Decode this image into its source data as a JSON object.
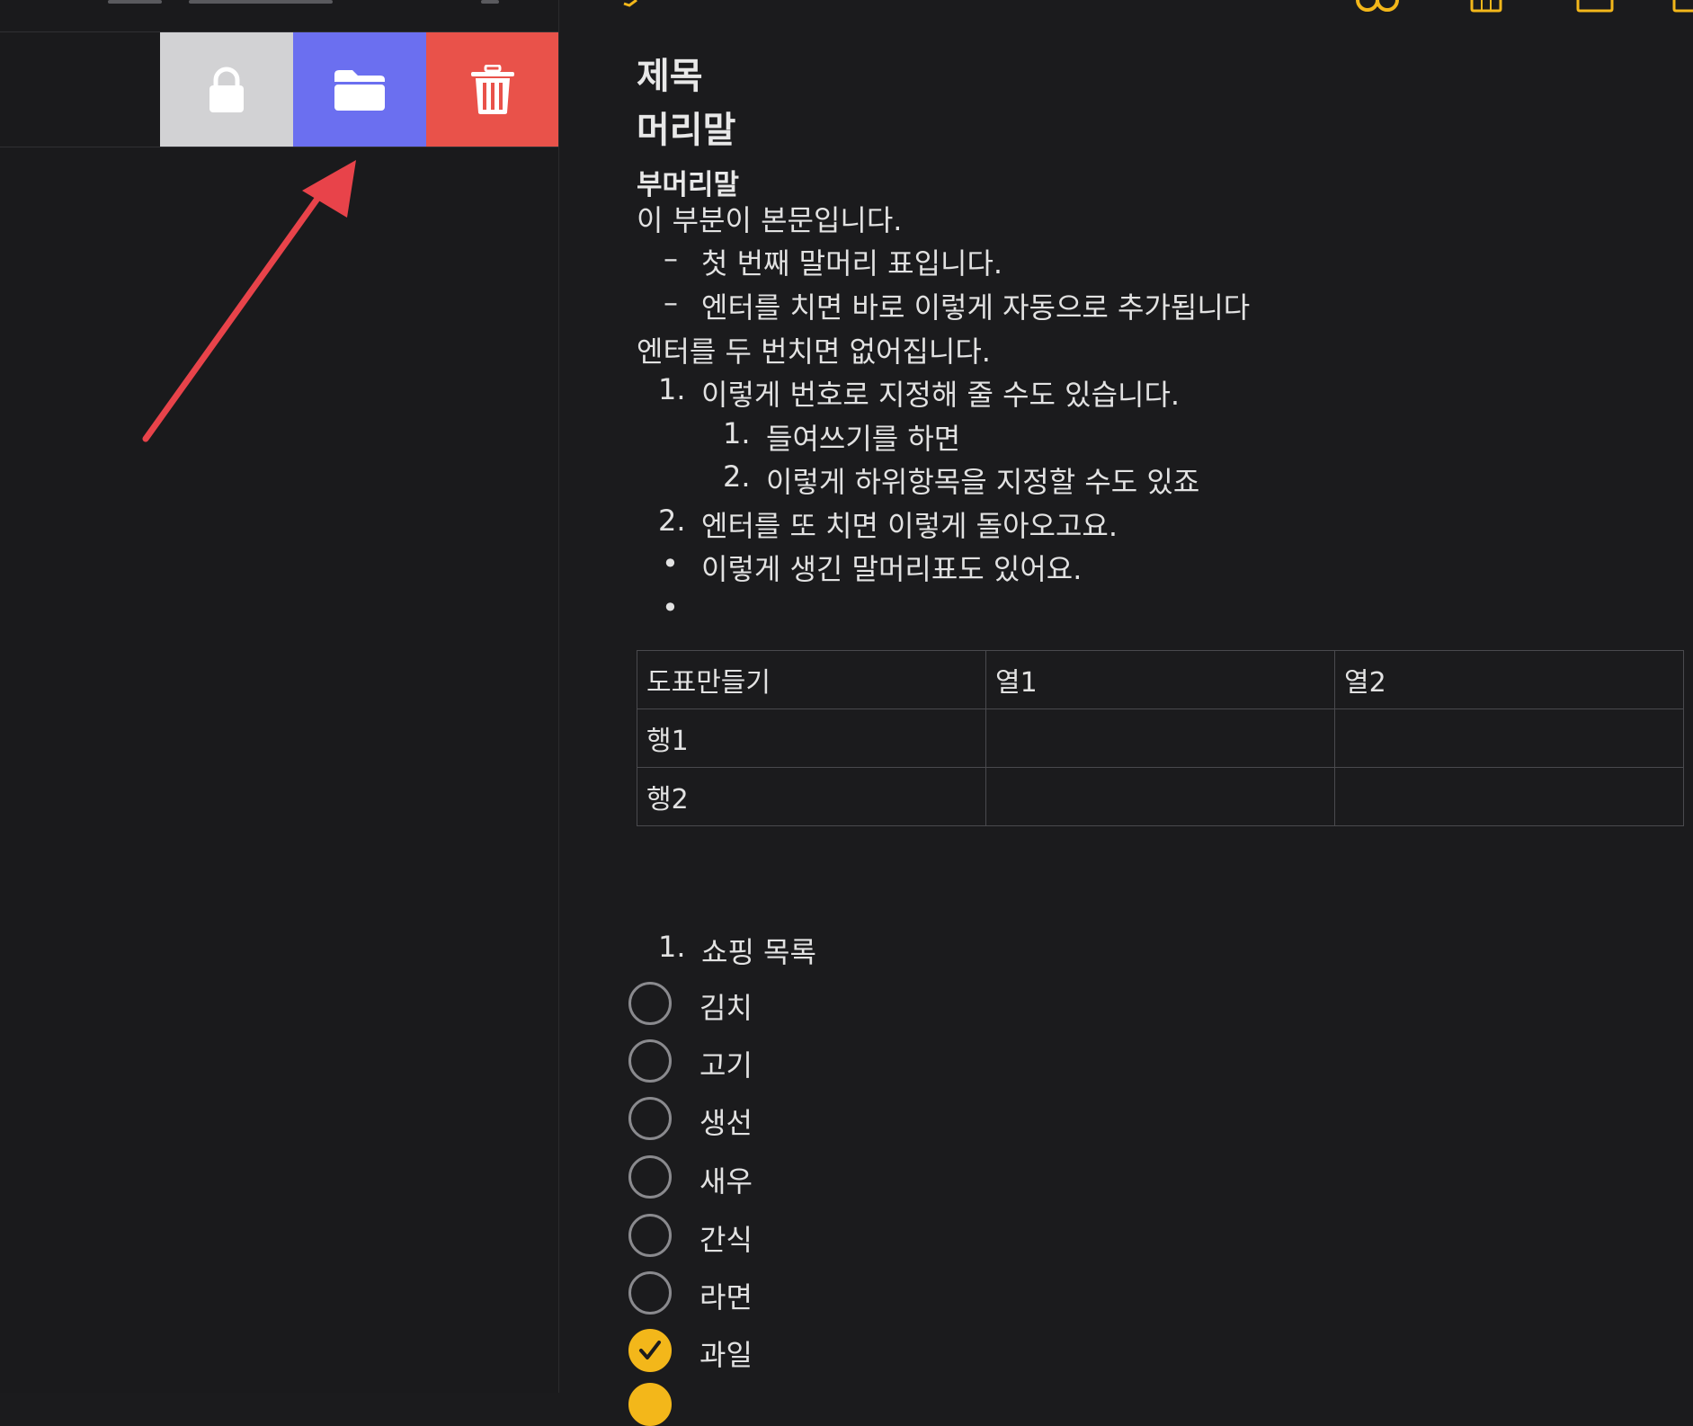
{
  "colors": {
    "background": "#1b1b1d",
    "lock": "#d2d2d4",
    "move": "#6b6ff0",
    "delete": "#e9524a",
    "accent": "#f3b71a",
    "arrow": "#e8434a"
  },
  "sidebar": {
    "actions": [
      {
        "name": "lock",
        "icon": "lock-icon"
      },
      {
        "name": "move-to-folder",
        "icon": "folder-icon"
      },
      {
        "name": "delete",
        "icon": "trash-icon"
      }
    ]
  },
  "note": {
    "title": "제목",
    "heading": "머리말",
    "subheading": "부머리말",
    "body": "이 부분이 본문입니다.",
    "dash_items": [
      "첫 번째 말머리 표입니다.",
      "엔터를 치면 바로 이렇게 자동으로 추가됩니다"
    ],
    "after_dash": "엔터를 두 번치면 없어집니다.",
    "numbered": [
      {
        "marker": "1.",
        "text": "이렇게 번호로 지정해 줄 수도 있습니다."
      },
      {
        "marker": "1.",
        "text": "들여쓰기를 하면"
      },
      {
        "marker": "2.",
        "text": "이렇게 하위항목을 지정할 수도 있죠"
      },
      {
        "marker": "2.",
        "text": "엔터를 또 치면 이렇게 돌아오고요."
      }
    ],
    "bullets": [
      "이렇게 생긴 말머리표도 있어요.",
      ""
    ],
    "table": {
      "rows": [
        [
          "도표만들기",
          "열1",
          "열2"
        ],
        [
          "행1",
          "",
          ""
        ],
        [
          "행2",
          "",
          ""
        ]
      ]
    },
    "list_header": {
      "marker": "1.",
      "text": "쇼핑 목록"
    },
    "checklist": [
      {
        "label": "김치",
        "checked": false
      },
      {
        "label": "고기",
        "checked": false
      },
      {
        "label": "생선",
        "checked": false
      },
      {
        "label": "새우",
        "checked": false
      },
      {
        "label": "간식",
        "checked": false
      },
      {
        "label": "라면",
        "checked": false
      },
      {
        "label": "과일",
        "checked": true
      }
    ]
  }
}
